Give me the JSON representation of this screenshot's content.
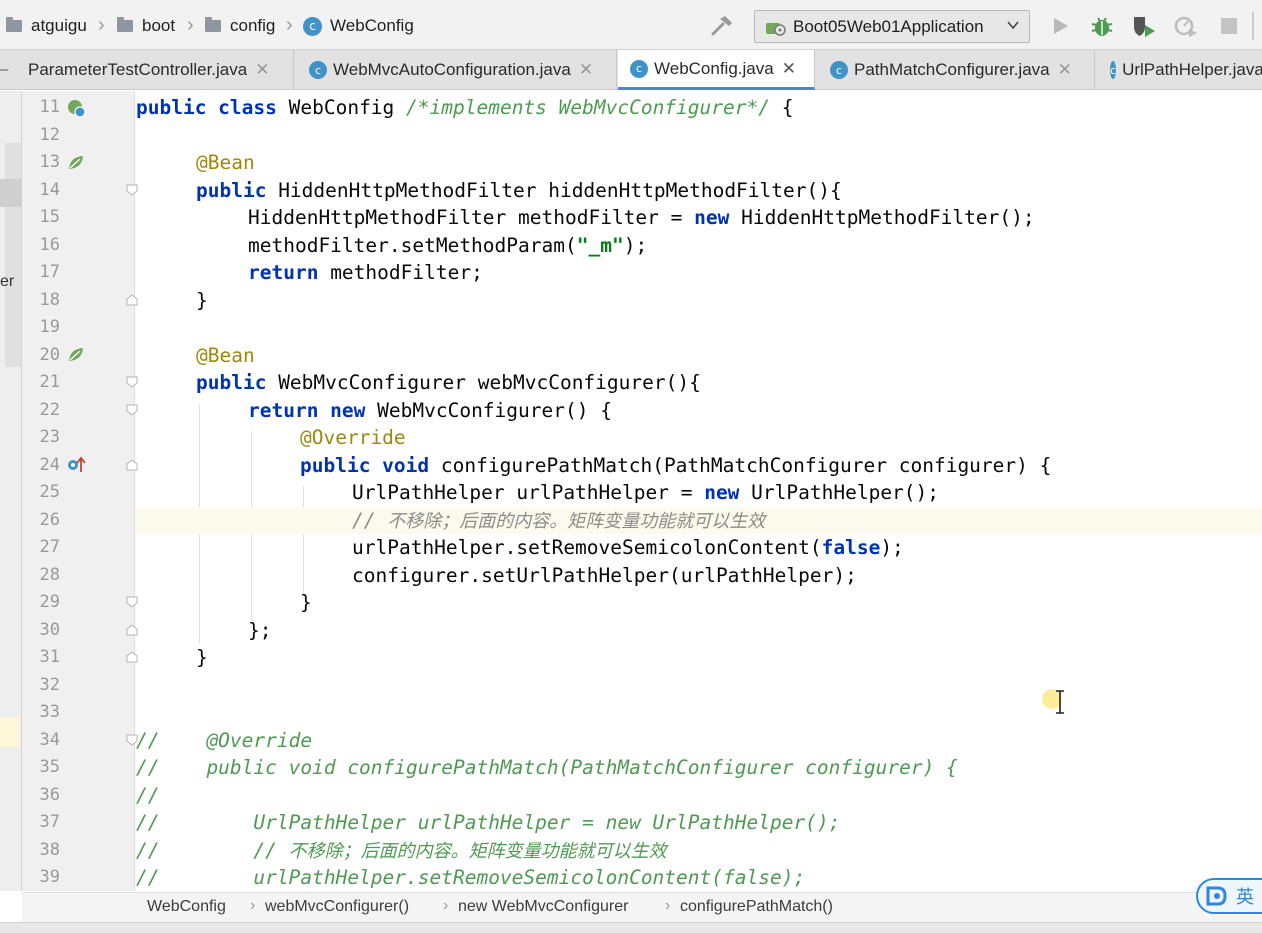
{
  "navbar": {
    "breadcrumb": [
      "atguigu",
      "boot",
      "config",
      "WebConfig"
    ],
    "run_configuration": "Boot05Web01Application"
  },
  "tabs": [
    {
      "label": "ParameterTestController.java",
      "active": false
    },
    {
      "label": "WebMvcAutoConfiguration.java",
      "active": false
    },
    {
      "label": "WebConfig.java",
      "active": true
    },
    {
      "label": "PathMatchConfigurer.java",
      "active": false
    },
    {
      "label": "UrlPathHelper.java",
      "active": false
    }
  ],
  "side_panel": {
    "partial_label": "er"
  },
  "editor": {
    "line_numbers": [
      "11",
      "12",
      "13",
      "14",
      "15",
      "16",
      "17",
      "18",
      "19",
      "20",
      "21",
      "22",
      "23",
      "24",
      "25",
      "26",
      "27",
      "28",
      "29",
      "30",
      "31",
      "32",
      "33",
      "34",
      "35",
      "36",
      "37",
      "38",
      "39"
    ],
    "current_line": "26",
    "lines": {
      "l11": {
        "kw1": "public class",
        "name": " WebConfig ",
        "cmt": "/*implements WebMvcConfigurer*/",
        "tail": " {"
      },
      "l13": {
        "ann": "@Bean"
      },
      "l14": {
        "kw": "public",
        "rest": " HiddenHttpMethodFilter hiddenHttpMethodFilter(){"
      },
      "l15": {
        "a": "HiddenHttpMethodFilter methodFilter = ",
        "kw": "new",
        "b": " HiddenHttpMethodFilter();"
      },
      "l16": {
        "a": "methodFilter.setMethodParam(",
        "str": "\"_m\"",
        "b": ");"
      },
      "l17": {
        "kw": "return",
        "rest": " methodFilter;"
      },
      "l18": {
        "text": "}"
      },
      "l20": {
        "ann": "@Bean"
      },
      "l21": {
        "kw": "public",
        "rest": " WebMvcConfigurer webMvcConfigurer(){"
      },
      "l22": {
        "kw": "return new",
        "rest": " WebMvcConfigurer() {"
      },
      "l23": {
        "ann": "@Override"
      },
      "l24": {
        "kw": "public void",
        "rest": " configurePathMatch(PathMatchConfigurer configurer) {"
      },
      "l25": {
        "a": "UrlPathHelper urlPathHelper = ",
        "kw": "new",
        "b": " UrlPathHelper();"
      },
      "l26": {
        "slashes": "// ",
        "cn": "不移除；后面的内容。矩阵变量功能就可以生效"
      },
      "l27": {
        "a": "urlPathHelper.setRemoveSemicolonContent(",
        "kw": "false",
        "b": ");"
      },
      "l28": {
        "text": "configurer.setUrlPathHelper(urlPathHelper);"
      },
      "l29": {
        "text": "}"
      },
      "l30": {
        "text": "};"
      },
      "l31": {
        "text": "}"
      },
      "l34": {
        "text": "//    @Override"
      },
      "l35": {
        "text": "//    public void configurePathMatch(PathMatchConfigurer configurer) {"
      },
      "l36": {
        "text": "//"
      },
      "l37": {
        "text": "//        UrlPathHelper urlPathHelper = new UrlPathHelper();"
      },
      "l38": {
        "slashes": "//        // ",
        "cn": "不移除；后面的内容。矩阵变量功能就可以生效"
      },
      "l39": {
        "text": "//        urlPathHelper.setRemoveSemicolonContent(false);"
      }
    }
  },
  "footer_breadcrumb": [
    "WebConfig",
    "webMvcConfigurer()",
    "new WebMvcConfigurer",
    "configurePathMatch()"
  ],
  "ime": {
    "label": "英"
  }
}
